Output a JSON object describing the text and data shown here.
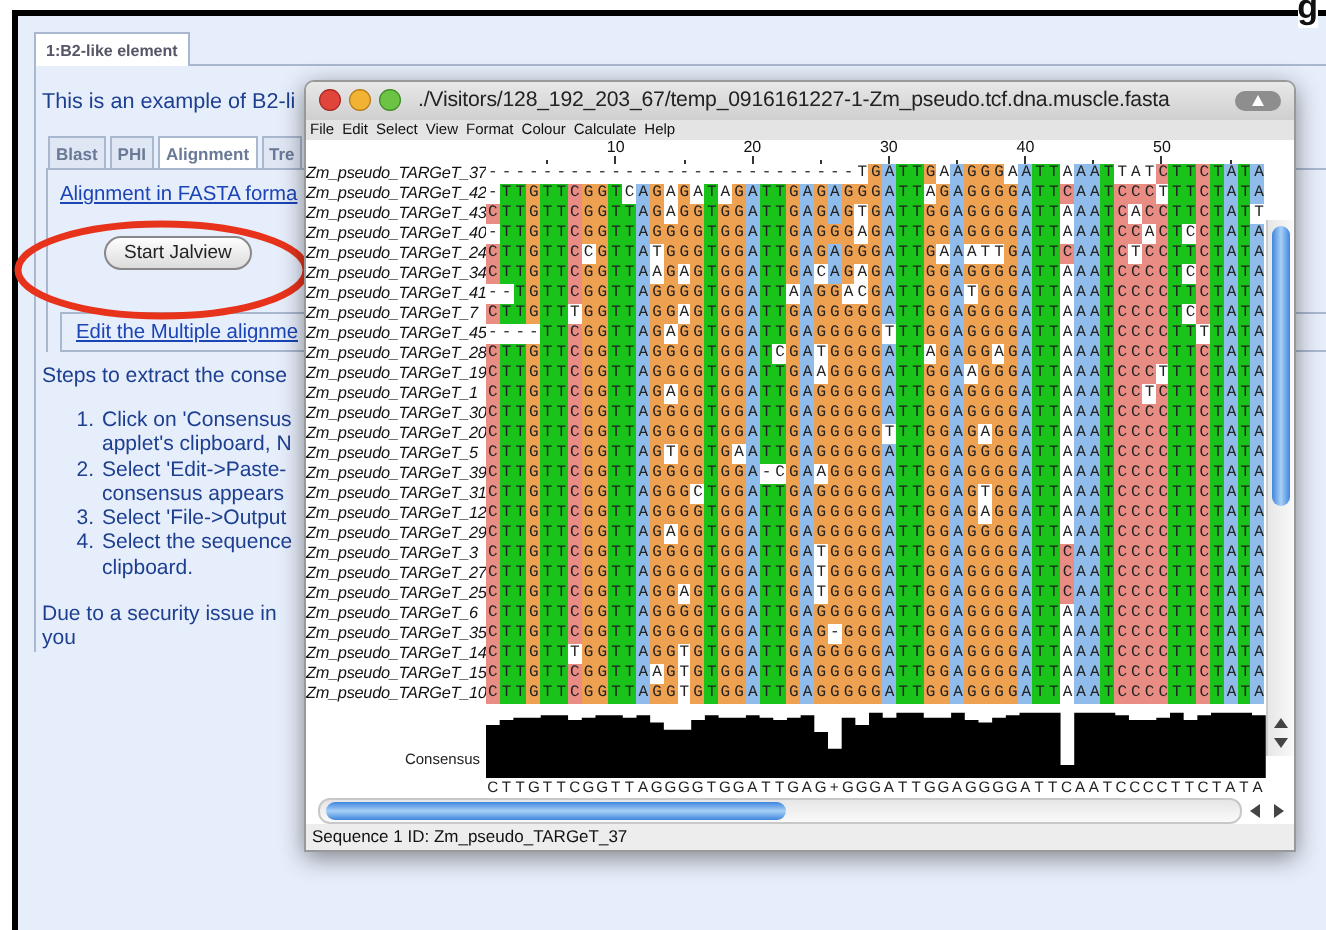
{
  "heading_fragment": "g",
  "page_tab": {
    "label": "1:B2-like element",
    "selected": true
  },
  "intro": "This is an example of B2-li",
  "tabs": [
    {
      "label": "Blast",
      "selected": false
    },
    {
      "label": "PHI",
      "selected": false
    },
    {
      "label": "Alignment",
      "selected": true
    },
    {
      "label": "Tre",
      "selected": false
    }
  ],
  "fasta_link": "Alignment in FASTA forma",
  "start_button": "Start Jalview",
  "edit_link": "Edit the Multiple alignme",
  "steps_heading": "Steps to extract the conse",
  "steps": [
    {
      "number": "1.",
      "lines": [
        "Click on 'Consensus",
        "applet's clipboard, N"
      ]
    },
    {
      "number": "2.",
      "lines": [
        "Select 'Edit->Paste-",
        "consensus appears"
      ]
    },
    {
      "number": "3.",
      "lines": [
        "Select 'File->Output"
      ]
    },
    {
      "number": "4.",
      "lines": [
        "Select the sequence",
        "clipboard."
      ]
    }
  ],
  "note_lines": [
    "Due to a security issue in",
    "you"
  ],
  "jalview": {
    "title": "./Visitors/128_192_203_67/temp_0916161227-1-Zm_pseudo.tcf.dna.muscle.fasta",
    "menu": [
      "File",
      "Edit",
      "Select",
      "View",
      "Format",
      "Colour",
      "Calculate",
      "Help"
    ],
    "ruler": [
      "10",
      "20",
      "30",
      "40",
      "50"
    ],
    "sequences": [
      {
        "name": "Zm_pseudo_TARGeT_37",
        "residues": "---------------------------TGATTGAAGGGAATTAAATTATCTTCTATA"
      },
      {
        "name": "Zm_pseudo_TARGeT_42",
        "residues": "-TTGTTCGGTCAGAGATAGATTGAGAGGGATTAGAGGGGATTCAATCCCTTTCTATA"
      },
      {
        "name": "Zm_pseudo_TARGeT_43",
        "residues": "CTTGTTCGGTTAGAGGTGGATTGAGAGTGATTGGAGGGGATTAAATCACCTTCTATT"
      },
      {
        "name": "Zm_pseudo_TARGeT_40",
        "residues": "-TTGTTCGGTTAGGGGTGGATTGAGGGAGATTGGAGGGGATTAAATCCACTCCTATA"
      },
      {
        "name": "Zm_pseudo_TARGeT_24",
        "residues": "CTTGTTCCGTTATGGGTGGATTGAGAGGGATTGAAATTGATTCAATCTCCTTCTATA"
      },
      {
        "name": "Zm_pseudo_TARGeT_34",
        "residues": "CTTGTTCGGTTAAGAGTGGATTGACAGAGATTGGAGGGGATTAAATCCCCTCCTATA"
      },
      {
        "name": "Zm_pseudo_TARGeT_41",
        "residues": "--TGTTCGGTTAGGGGTGGATTAAGGACGATTGGATGGGATTAAATCCCCTTCTATA"
      },
      {
        "name": "Zm_pseudo_TARGeT_7",
        "residues": "CTTGTTTGGTTAGGAGTGGATTGAGGGGGATTGGAGGGGATTAAATCCCCTCCTATA"
      },
      {
        "name": "Zm_pseudo_TARGeT_45",
        "residues": "----TTCGGTTAGAGGTGGATTGAGGGGGTTTGGAGGGGATTAAATCCCCTTTTATA"
      },
      {
        "name": "Zm_pseudo_TARGeT_28",
        "residues": "CTTGTTCGGTTAGGGGTGGATCGATGGGGATTAGAGGAGATTAAATCCCCTTCTATA"
      },
      {
        "name": "Zm_pseudo_TARGeT_19",
        "residues": "CTTGTTCGGTTAGGGGTGGATTGAAGGGGATTGGAAGGGATTAAATCCCTTTCTATA"
      },
      {
        "name": "Zm_pseudo_TARGeT_1",
        "residues": "CTTGTTCGGTTAGAGGTGGATTGAGGGGGATTGGAGGGGATTAAATCCTCTTCTATA"
      },
      {
        "name": "Zm_pseudo_TARGeT_30",
        "residues": "CTTGTTCGGTTAGGGGTGGATTGAGGGGGATTGGAGGGGATTAAATCCCCTTCTATA"
      },
      {
        "name": "Zm_pseudo_TARGeT_20",
        "residues": "CTTGTTCGGTTAGGGGTGGATTGAGGGGGTTTGGAGAGGATTAAATCCCCTTCTATA"
      },
      {
        "name": "Zm_pseudo_TARGeT_5",
        "residues": "CTTGTTCGGTTAGTGGTGAATTGAGGGGGATTGGAGGGGATTAAATCCCCTTCTATA"
      },
      {
        "name": "Zm_pseudo_TARGeT_39",
        "residues": "CTTGTTCGGTTAGGGGTGGA-CGAAGGGGATTGGAGGGGATTAAATCCCCTTCTATA"
      },
      {
        "name": "Zm_pseudo_TARGeT_31",
        "residues": "CTTGTTCGGTTAGGGCTGGATTGAGGGGGATTGGAGTGGATTAAATCCCCTTCTATA"
      },
      {
        "name": "Zm_pseudo_TARGeT_12",
        "residues": "CTTGTTCGGTTAGGGGTGGATTGAGGGGGATTGGAGAGGATTAAATCCCCTTCTATA"
      },
      {
        "name": "Zm_pseudo_TARGeT_29",
        "residues": "CTTGTTCGGTTAGAGGTGGATTGAGGGGGATTGGAGGGGATTAAATCCCCTTCTATA"
      },
      {
        "name": "Zm_pseudo_TARGeT_3",
        "residues": "CTTGTTCGGTTAGGGGTGGATTGATGGGGATTGGAGGGGATTCAATCCCCTTCTATA"
      },
      {
        "name": "Zm_pseudo_TARGeT_27",
        "residues": "CTTGTTCGGTTAGGGGTGGATTGATGGGGATTGGAGGGGATTCAATCCCCTTCTATA"
      },
      {
        "name": "Zm_pseudo_TARGeT_25",
        "residues": "CTTGTTCGGTTAGGAGTGGATTGATGGGGATTGGAGGGGATTCAATCCCCTTCTATA"
      },
      {
        "name": "Zm_pseudo_TARGeT_6",
        "residues": "CTTGTTCGGTTAGGGGTGGATTGAGGGGGATTGGAGGGGATTAAATCCCCTTCTATA"
      },
      {
        "name": "Zm_pseudo_TARGeT_35",
        "residues": "CTTGTTCGGTTAGGGGTGGATTGAG-GGGATTGGAGGGGATTAAATCCCCTTCTATA"
      },
      {
        "name": "Zm_pseudo_TARGeT_14",
        "residues": "CTTGTTTGGTTAGGTGTGGATTGAGGGGGATTGGAGGGGATTAAATCCCCTTCTATA"
      },
      {
        "name": "Zm_pseudo_TARGeT_15",
        "residues": "CTTGTTCGGTTAAGTGTGGATTGAGGGGGATTGGAGGGGATTAAATCCCCTTCTATA"
      },
      {
        "name": "Zm_pseudo_TARGeT_10",
        "residues": "CTTGTTCGGTTAGGTGTGGATTGAGGGGGATTGGAGGGGATTAAATCCCCTTCTATA"
      }
    ],
    "consensus_label": "Consensus",
    "consensus": "CTTGTTCGGTTAGGGGTGGATTGAG+GGGATTGGAGGGGATTCAATCCCCTTCTATA",
    "status": "Sequence 1 ID: Zm_pseudo_TARGeT_37"
  }
}
